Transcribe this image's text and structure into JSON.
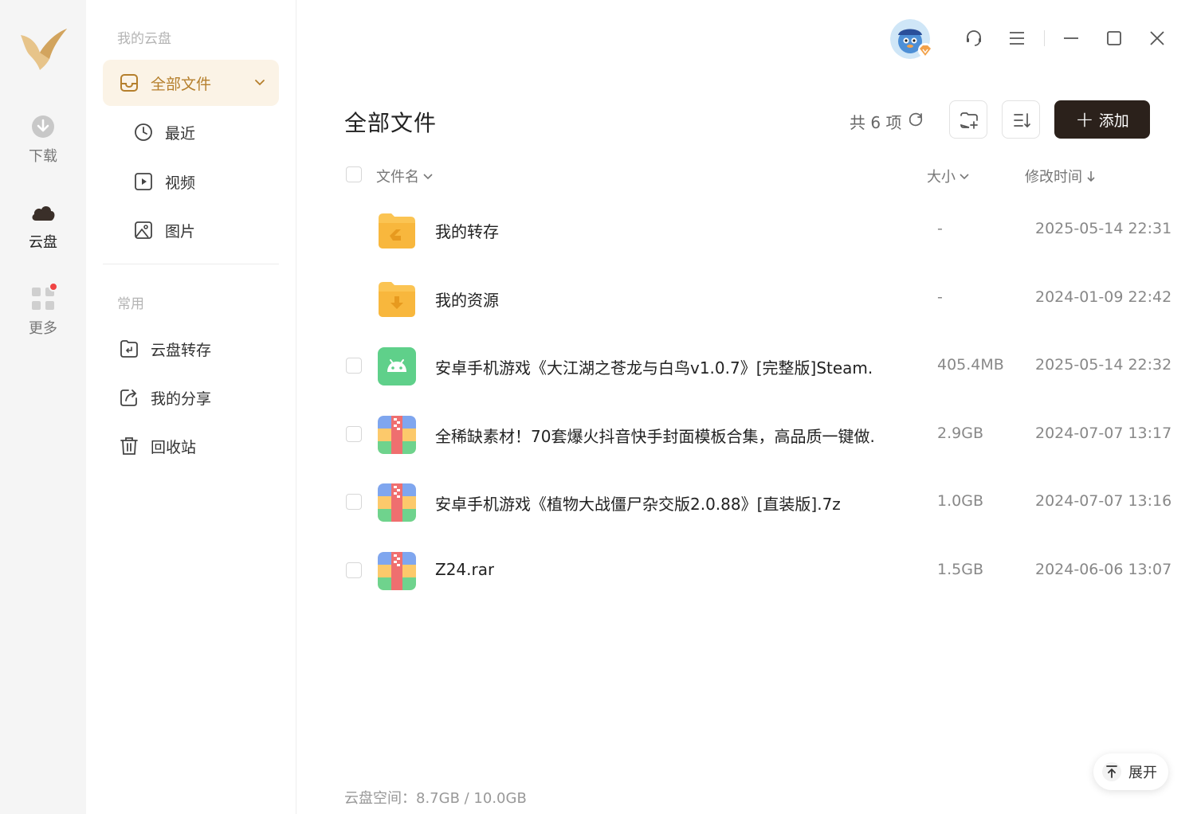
{
  "rail": {
    "items": [
      {
        "label": "下载",
        "icon": "download-icon"
      },
      {
        "label": "云盘",
        "icon": "cloud-icon",
        "active": true
      },
      {
        "label": "更多",
        "icon": "apps-grid-icon",
        "has_notification": true
      }
    ]
  },
  "sidebar": {
    "section_my_drive": "我的云盘",
    "all_files": "全部文件",
    "recent": "最近",
    "video": "视频",
    "images": "图片",
    "section_common": "常用",
    "cloud_transfer": "云盘转存",
    "my_share": "我的分享",
    "recycle_bin": "回收站"
  },
  "main": {
    "title": "全部文件",
    "count_text": "共 6 项",
    "add_label": "添加",
    "columns": {
      "name": "文件名",
      "size": "大小",
      "modified": "修改时间"
    },
    "files": [
      {
        "name": "我的转存",
        "size": "-",
        "modified": "2025-05-14 22:31",
        "type": "folder-transfer"
      },
      {
        "name": "我的资源",
        "size": "-",
        "modified": "2024-01-09 22:42",
        "type": "folder-download"
      },
      {
        "name": "安卓手机游戏《大江湖之苍龙与白鸟v1.0.7》[完整版]Steam...",
        "size": "405.4MB",
        "modified": "2025-05-14 22:32",
        "type": "android"
      },
      {
        "name": "全稀缺素材！70套爆火抖音快手封面模板合集，高品质一键做...",
        "size": "2.9GB",
        "modified": "2024-07-07 13:17",
        "type": "archive"
      },
      {
        "name": "安卓手机游戏《植物大战僵尸杂交版2.0.88》[直装版].7z",
        "size": "1.0GB",
        "modified": "2024-07-07 13:16",
        "type": "archive"
      },
      {
        "name": "Z24.rar",
        "size": "1.5GB",
        "modified": "2024-06-06 13:07",
        "type": "archive"
      }
    ],
    "storage_text": "云盘空间：8.7GB / 10.0GB",
    "expand_label": "展开"
  },
  "colors": {
    "accent": "#b57f2c",
    "active_bg": "#fbf3e6",
    "add_button": "#2b211b",
    "folder": "#f8b73d",
    "android": "#5fd08a"
  }
}
